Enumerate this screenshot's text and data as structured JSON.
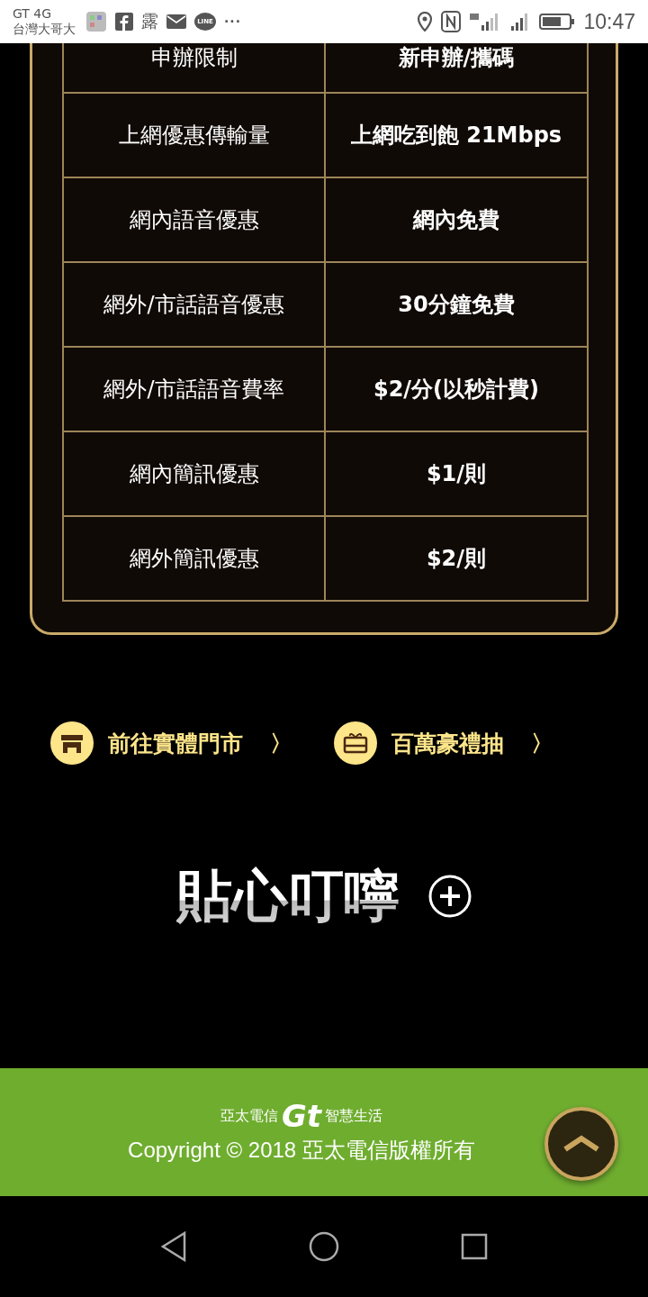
{
  "status_bar": {
    "carrier_network": "GT 4G",
    "carrier_name": "台灣大哥大",
    "app_glyph": "露",
    "line_label": "LINE",
    "more": "···",
    "time": "10:47"
  },
  "plan_table": {
    "rows": [
      {
        "label": "申辦限制",
        "value": "新申辦/攜碼"
      },
      {
        "label": "上網優惠傳輸量",
        "value": "上網吃到飽 21Mbps"
      },
      {
        "label": "網內語音優惠",
        "value": "網內免費"
      },
      {
        "label": "網外/市話語音優惠",
        "value": "30分鐘免費"
      },
      {
        "label": "網外/市話語音費率",
        "value": "$2/分(以秒計費)"
      },
      {
        "label": "網內簡訊優惠",
        "value": "$1/則"
      },
      {
        "label": "網外簡訊優惠",
        "value": "$2/則"
      }
    ]
  },
  "links": [
    {
      "kind": "store",
      "label": "前往實體門市",
      "arrow": "〉"
    },
    {
      "kind": "gift",
      "label": "百萬豪禮抽",
      "arrow": "〉"
    }
  ],
  "notice": {
    "title": "貼心叮嚀",
    "expanded": false
  },
  "footer": {
    "brand_left": "亞太電信",
    "brand_logo": "Gt",
    "brand_right": "智慧生活",
    "copyright": "Copyright © 2018 亞太電信版權所有"
  }
}
